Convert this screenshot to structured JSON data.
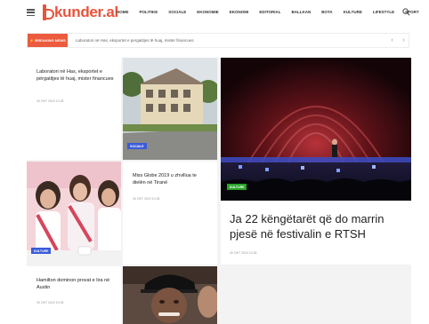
{
  "header": {
    "logo_text": "kunder.al",
    "nav": [
      "HOME",
      "POLITIKE",
      "SOCIALE",
      "EKONOMIE",
      "EKONOMI",
      "EDITORIAL",
      "BALLKAN",
      "BOTA",
      "KULTURE",
      "LIFESTYLE",
      "SPORT"
    ]
  },
  "breaking": {
    "badge_label": "⚡ BREAKING NEWS",
    "text": "Laboratori në Has, eksportet e pergatitjes të huaj, mister financues",
    "prev_label": "‹",
    "next_label": "›"
  },
  "cards": {
    "card1": {
      "title": "Laboratori në Has, eksportet e përgatitjes të huaj, mister financues",
      "date": "30 OKT 2019 10:35"
    },
    "card1_tag": "SOCIALE",
    "card2": {
      "title": "Miss Globe 2019 u zhvillua te dielën në Tiranë",
      "date": "30 OKT 2019 10:35"
    },
    "card2_tag": "KULTURE",
    "card3": {
      "title": "Hamilton dominon provat e lira në Austin",
      "date": "30 OKT 2019 10:35"
    },
    "featured": {
      "tag": "KULTURE",
      "title": "Ja 22 këngëtarët që do marrin pjesë në festivalin e RTSH",
      "date": "30 OKT 2019 10:35"
    }
  },
  "colors": {
    "accent": "#ec5b3d",
    "tag_blue": "#3a5bd9",
    "tag_green": "#2aa52a"
  }
}
